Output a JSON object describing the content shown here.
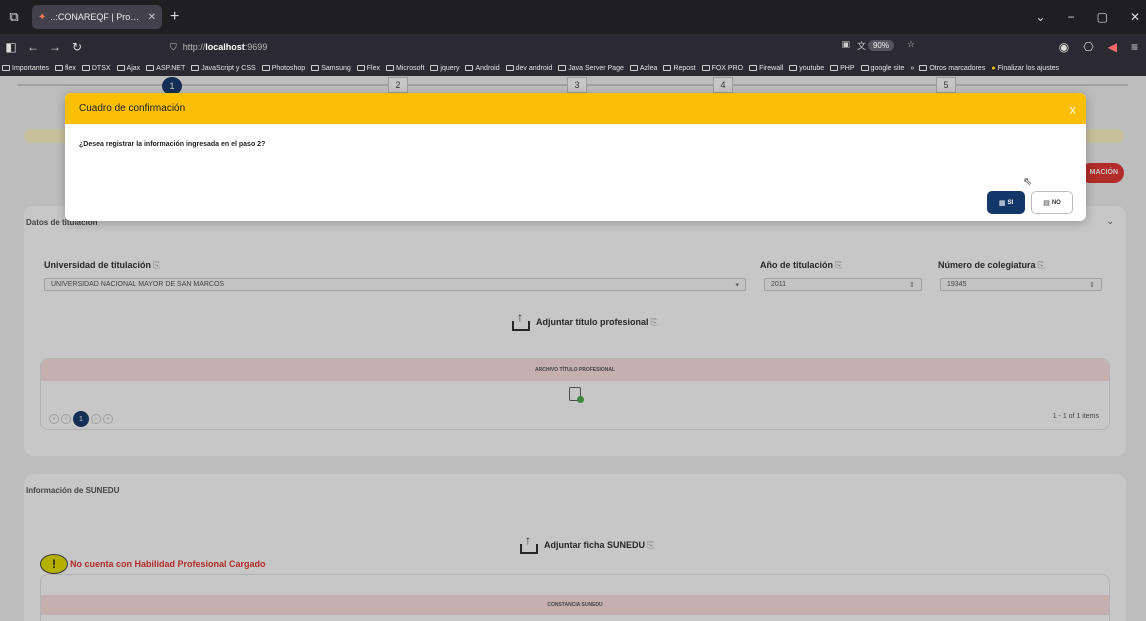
{
  "browser": {
    "tab_title": "..:CONAREQF | Proceso de Inscr",
    "url_scheme": "http://",
    "url_host": "localhost",
    "url_port": ":9699",
    "zoom": "90%",
    "bookmarks": [
      "Importantes",
      "flex",
      "DTSX",
      "Ajax",
      "ASP.NET",
      "JavaScript y CSS",
      "Photoshop",
      "Samsung",
      "Flex",
      "Microsoft",
      "jquery",
      "Android",
      "dev android",
      "Java Server Page",
      "Azlea",
      "Repost",
      "FOX PRO",
      "Firewall",
      "youtube",
      "PHP",
      "google site"
    ],
    "bookmarks_more": "»",
    "bookmarks_other": "Otros marcadores",
    "bookmarks_finish": "Finalizar los ajustes"
  },
  "stepper": {
    "steps": [
      "1",
      "2",
      "3",
      "4",
      "5"
    ]
  },
  "header_button": "MACIÓN",
  "titulacion": {
    "title": "Datos de titulación",
    "university_label": "Universidad de titulación",
    "university_value": "UNIVERSIDAD NACIONAL MAYOR DE SAN MARCOS",
    "year_label": "Año de titulación",
    "year_value": "2011",
    "colegiatura_label": "Número de colegiatura",
    "colegiatura_value": "19345",
    "attach_label": "Adjuntar título profesional",
    "grid_header": "ARCHIVO TÍTULO PROFESIONAL",
    "pager_current": "1",
    "items_info": "1 - 1 of 1 items"
  },
  "sunedu": {
    "title": "Información de SUNEDU",
    "attach_label": "Adjuntar ficha SUNEDU",
    "warning": "No cuenta con Habilidad Profesional Cargado",
    "warning_icon": "!",
    "grid_header": "CONSTANCIA SUNEDU"
  },
  "modal": {
    "title": "Cuadro de confirmación",
    "close": "X",
    "message": "¿Desea registrar la información ingresada en el paso 2?",
    "yes_label": "SI",
    "no_label": "NO"
  },
  "colors": {
    "accent": "#fbbf06",
    "primary": "#133768",
    "danger": "#e53935"
  }
}
